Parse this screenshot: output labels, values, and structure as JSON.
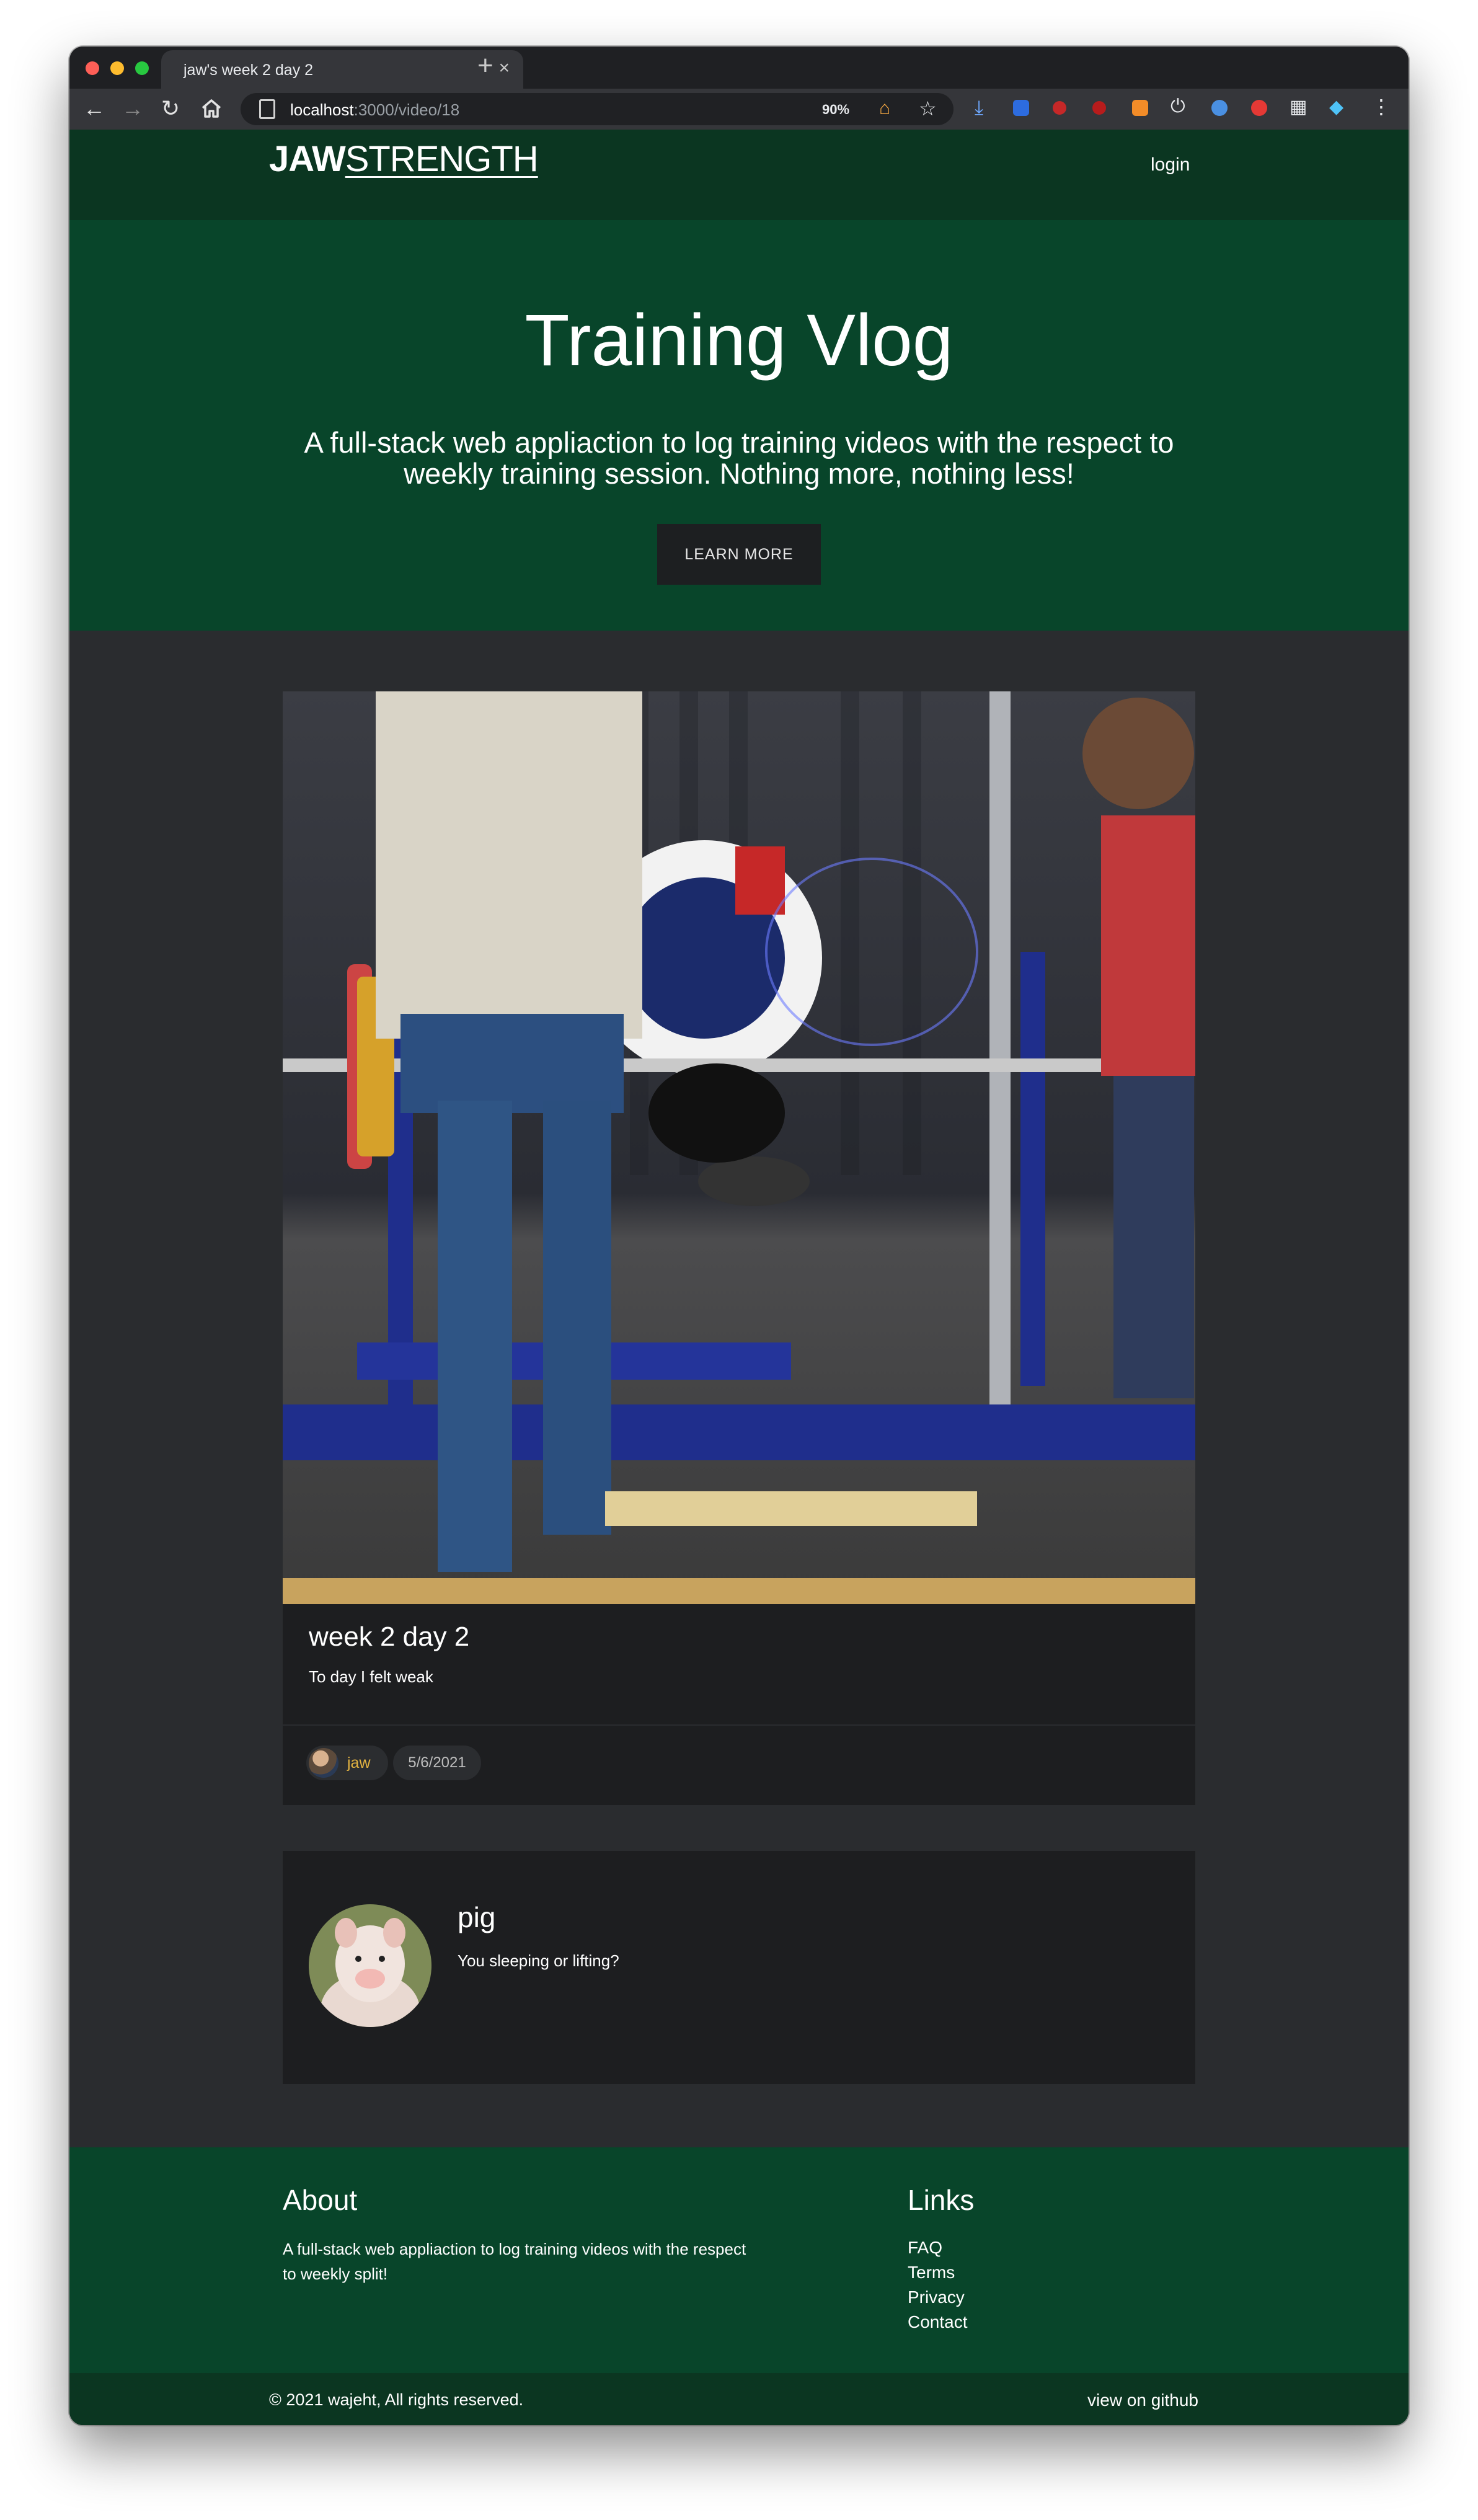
{
  "browser": {
    "tab_title": "jaw's week 2 day 2",
    "url_host": "localhost",
    "url_path": ":3000/video/18",
    "zoom": "90%"
  },
  "navbar": {
    "brand_bold": "JAW",
    "brand_light": "STRENGTH",
    "login": "login"
  },
  "hero": {
    "title": "Training Vlog",
    "subtitle": "A full-stack web appliaction to log training videos with the respect to weekly training session. Nothing more, nothing less!",
    "button": "LEARN MORE"
  },
  "video": {
    "title": "week 2 day 2",
    "description": "To day I felt weak",
    "author": "jaw",
    "date": "5/6/2021"
  },
  "comment": {
    "name": "pig",
    "text": "You sleeping or lifting?"
  },
  "footer": {
    "about_heading": "About",
    "about_text": "A full-stack web appliaction to log training videos with the respect to weekly split!",
    "links_heading": "Links",
    "links": [
      "FAQ",
      "Terms",
      "Privacy",
      "Contact"
    ],
    "copyright": "© 2021 wajeht, All rights reserved.",
    "github": "view on github"
  },
  "colors": {
    "nav_bg": "#0b3621",
    "hero_bg": "#08452a",
    "page_bg": "#2a2c2f",
    "card_bg": "#1d1e20",
    "author_accent": "#e3b341"
  }
}
